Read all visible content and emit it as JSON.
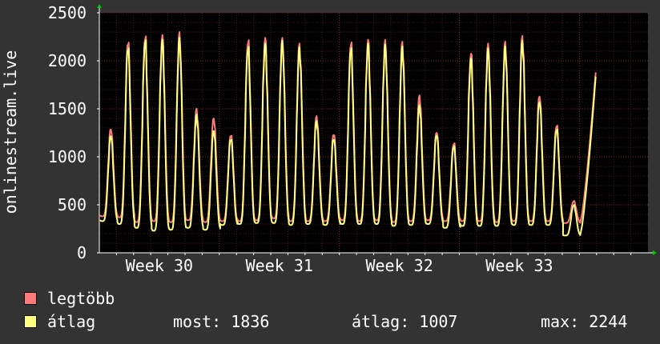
{
  "chart_data": {
    "type": "line",
    "ylabel": "onlinestream.live",
    "ylim": [
      0,
      2500
    ],
    "yticks": [
      0,
      500,
      1000,
      1500,
      2000,
      2500
    ],
    "xlim": [
      0,
      32
    ],
    "x_ticks": [
      {
        "x": 3.5,
        "label": "Week 30"
      },
      {
        "x": 10.5,
        "label": "Week 31"
      },
      {
        "x": 17.5,
        "label": "Week 32"
      },
      {
        "x": 24.5,
        "label": "Week 33"
      }
    ],
    "grid": true,
    "background": "#000000",
    "grid_color": "#7a2020",
    "series": [
      {
        "name": "legtöbb",
        "color": "#ff7b7b",
        "daily_peak": [
          1300,
          2220,
          2260,
          2270,
          2300,
          1500,
          1410,
          1240,
          2220,
          2240,
          2240,
          2180,
          1430,
          1250,
          2200,
          2220,
          2220,
          2200,
          1640,
          1270,
          1150,
          2080,
          2180,
          2200,
          2260,
          1650,
          1340,
          540
        ],
        "daily_low": [
          380,
          370,
          320,
          330,
          320,
          340,
          320,
          330,
          330,
          340,
          360,
          330,
          330,
          330,
          340,
          330,
          340,
          320,
          330,
          340,
          330,
          330,
          330,
          320,
          330,
          330,
          330,
          310
        ],
        "last_value": 1880
      },
      {
        "name": "átlag",
        "color": "#ffff80",
        "daily_peak": [
          1230,
          2160,
          2220,
          2220,
          2240,
          1440,
          1280,
          1200,
          2150,
          2180,
          2210,
          2140,
          1380,
          1200,
          2140,
          2180,
          2170,
          2150,
          1540,
          1240,
          1120,
          2030,
          2130,
          2150,
          2210,
          1590,
          1300,
          500
        ],
        "daily_low": [
          330,
          300,
          260,
          230,
          240,
          260,
          240,
          290,
          300,
          310,
          310,
          290,
          300,
          290,
          300,
          300,
          300,
          280,
          290,
          300,
          260,
          280,
          280,
          280,
          290,
          290,
          290,
          180
        ],
        "last_value": 1836
      }
    ],
    "legend": [
      {
        "label": "legtöbb",
        "color": "#ff7b7b"
      },
      {
        "label": "átlag",
        "color": "#ffff80"
      }
    ],
    "stats": {
      "most": "most: 1836",
      "atlag": "átlag: 1007",
      "max": "max: 2244"
    }
  }
}
